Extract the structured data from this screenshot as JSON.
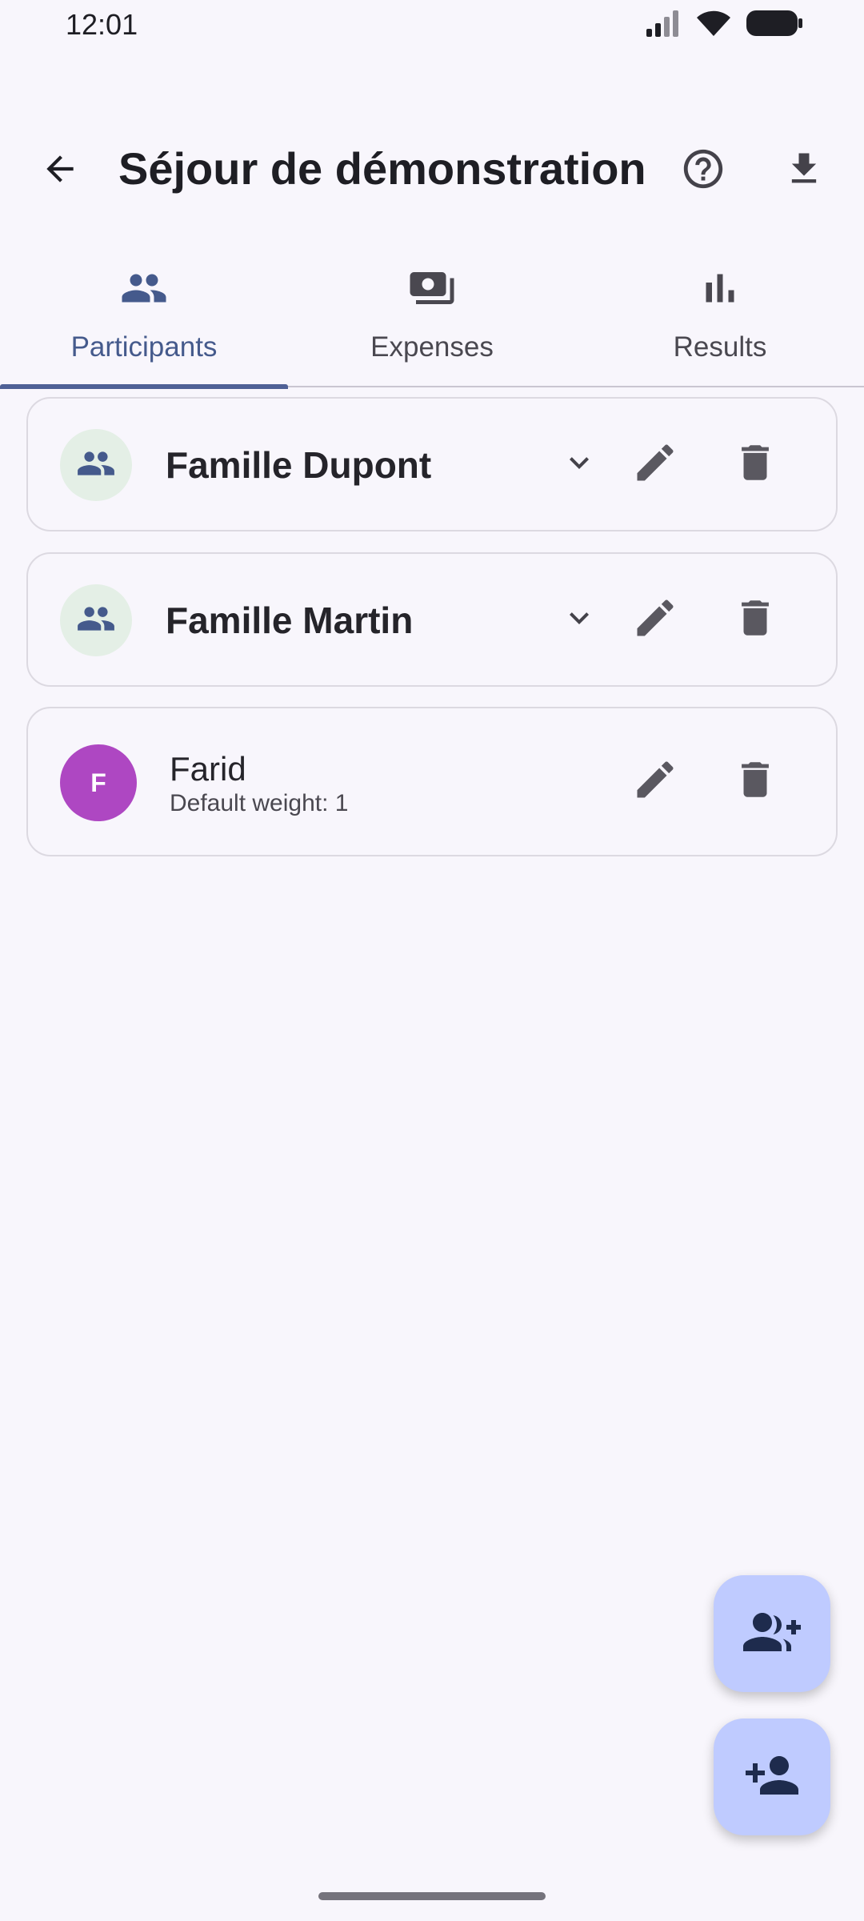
{
  "status_bar": {
    "time": "12:01",
    "icons": [
      "signal-icon",
      "wifi-icon",
      "battery-icon"
    ]
  },
  "app_bar": {
    "title": "Séjour de démonstration",
    "icons": {
      "back": "arrow-left-icon",
      "help": "help-circle-icon",
      "download": "download-icon"
    }
  },
  "tabs": [
    {
      "label": "Participants",
      "icon": "group-icon",
      "active": true
    },
    {
      "label": "Expenses",
      "icon": "payments-icon",
      "active": false
    },
    {
      "label": "Results",
      "icon": "bar-chart-icon",
      "active": false
    }
  ],
  "participants": [
    {
      "type": "group",
      "name": "Famille Dupont",
      "icon": "group-icon"
    },
    {
      "type": "group",
      "name": "Famille Martin",
      "icon": "group-icon"
    },
    {
      "type": "person",
      "initial": "F",
      "name": "Farid",
      "subtitle": "Default weight: 1",
      "avatar_color": "#AE47C2"
    }
  ],
  "fabs": [
    {
      "icon": "group-add-icon"
    },
    {
      "icon": "person-add-icon"
    }
  ],
  "colors": {
    "background": "#F8F6FC",
    "accent": "#4F6196",
    "fab": "#BFCBFF",
    "group_avatar_bg": "#E4EFE6"
  }
}
